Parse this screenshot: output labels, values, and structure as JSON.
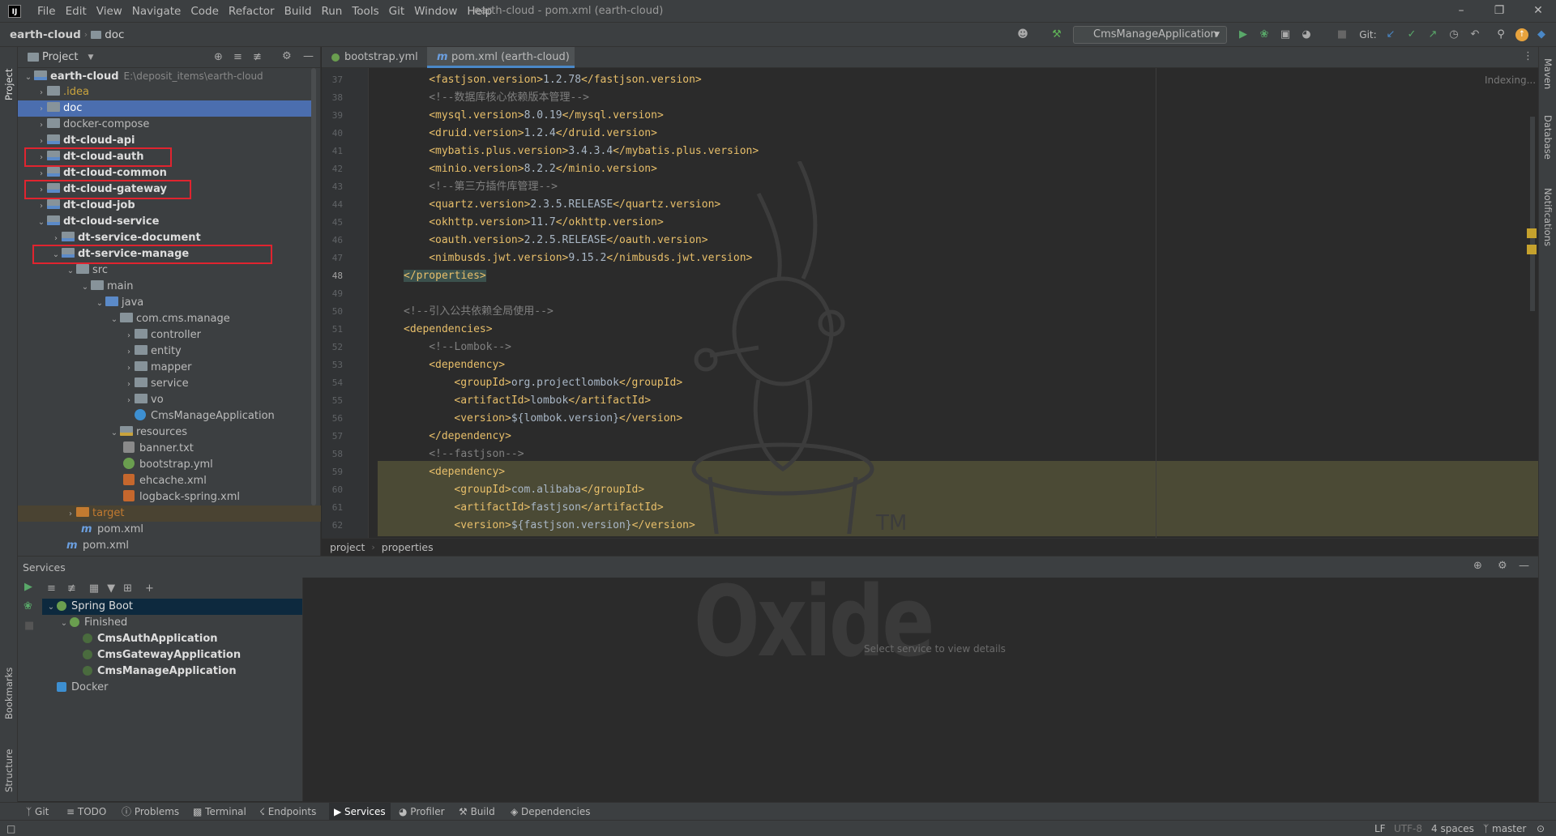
{
  "menubar": {
    "logo": "IJ",
    "items": [
      "File",
      "Edit",
      "View",
      "Navigate",
      "Code",
      "Refactor",
      "Build",
      "Run",
      "Tools",
      "Git",
      "Window",
      "Help"
    ],
    "title": "earth-cloud - pom.xml (earth-cloud)"
  },
  "navbar": {
    "project": "earth-cloud",
    "folder": "doc",
    "run_config": "CmsManageApplication",
    "git_label": "Git:"
  },
  "project_panel": {
    "title": "Project",
    "items": [
      {
        "label": "earth-cloud",
        "path": "E:\\deposit_items\\earth-cloud"
      },
      {
        "label": ".idea"
      },
      {
        "label": "doc"
      },
      {
        "label": "docker-compose"
      },
      {
        "label": "dt-cloud-api"
      },
      {
        "label": "dt-cloud-auth"
      },
      {
        "label": "dt-cloud-common"
      },
      {
        "label": "dt-cloud-gateway"
      },
      {
        "label": "dt-cloud-job"
      },
      {
        "label": "dt-cloud-service"
      },
      {
        "label": "dt-service-document"
      },
      {
        "label": "dt-service-manage"
      },
      {
        "label": "src"
      },
      {
        "label": "main"
      },
      {
        "label": "java"
      },
      {
        "label": "com.cms.manage"
      },
      {
        "label": "controller"
      },
      {
        "label": "entity"
      },
      {
        "label": "mapper"
      },
      {
        "label": "service"
      },
      {
        "label": "vo"
      },
      {
        "label": "CmsManageApplication"
      },
      {
        "label": "resources"
      },
      {
        "label": "banner.txt"
      },
      {
        "label": "bootstrap.yml"
      },
      {
        "label": "ehcache.xml"
      },
      {
        "label": "logback-spring.xml"
      },
      {
        "label": "target"
      },
      {
        "label": "pom.xml"
      },
      {
        "label": "pom.xml"
      }
    ]
  },
  "editor": {
    "tabs": [
      "bootstrap.yml",
      "pom.xml (earth-cloud)"
    ],
    "indexing": "Indexing...",
    "lines": [
      {
        "n": "37",
        "indent": 4,
        "parts": [
          [
            "tag",
            "<fastjson.version>"
          ],
          [
            "txt",
            "1.2.78"
          ],
          [
            "tag",
            "</fastjson.version>"
          ]
        ]
      },
      {
        "n": "38",
        "indent": 4,
        "parts": [
          [
            "cm",
            "<!--数据库核心依赖版本管理-->"
          ]
        ]
      },
      {
        "n": "39",
        "indent": 4,
        "parts": [
          [
            "tag",
            "<mysql.version>"
          ],
          [
            "txt",
            "8.0.19"
          ],
          [
            "tag",
            "</mysql.version>"
          ]
        ]
      },
      {
        "n": "40",
        "indent": 4,
        "parts": [
          [
            "tag",
            "<druid.version>"
          ],
          [
            "txt",
            "1.2.4"
          ],
          [
            "tag",
            "</druid.version>"
          ]
        ]
      },
      {
        "n": "41",
        "indent": 4,
        "parts": [
          [
            "tag",
            "<mybatis.plus.version>"
          ],
          [
            "txt",
            "3.4.3.4"
          ],
          [
            "tag",
            "</mybatis.plus.version>"
          ]
        ]
      },
      {
        "n": "42",
        "indent": 4,
        "parts": [
          [
            "tag",
            "<minio.version>"
          ],
          [
            "txt",
            "8.2.2"
          ],
          [
            "tag",
            "</minio.version>"
          ]
        ]
      },
      {
        "n": "43",
        "indent": 4,
        "parts": [
          [
            "cm",
            "<!--第三方插件库管理-->"
          ]
        ]
      },
      {
        "n": "44",
        "indent": 4,
        "parts": [
          [
            "tag",
            "<quartz.version>"
          ],
          [
            "txt",
            "2.3.5.RELEASE"
          ],
          [
            "tag",
            "</quartz.version>"
          ]
        ]
      },
      {
        "n": "45",
        "indent": 4,
        "parts": [
          [
            "tag",
            "<okhttp.version>"
          ],
          [
            "txt",
            "11.7"
          ],
          [
            "tag",
            "</okhttp.version>"
          ]
        ]
      },
      {
        "n": "46",
        "indent": 4,
        "parts": [
          [
            "tag",
            "<oauth.version>"
          ],
          [
            "txt",
            "2.2.5.RELEASE"
          ],
          [
            "tag",
            "</oauth.version>"
          ]
        ]
      },
      {
        "n": "47",
        "indent": 4,
        "parts": [
          [
            "tag",
            "<nimbusds.jwt.version>"
          ],
          [
            "txt",
            "9.15.2"
          ],
          [
            "tag",
            "</nimbusds.jwt.version>"
          ]
        ]
      },
      {
        "n": "48",
        "indent": 0,
        "parts": [
          [
            "tag",
            "</properties>"
          ]
        ]
      },
      {
        "n": "49",
        "indent": 0,
        "parts": []
      },
      {
        "n": "50",
        "indent": 0,
        "parts": [
          [
            "cm",
            "<!--引入公共依赖全局使用-->"
          ]
        ]
      },
      {
        "n": "51",
        "indent": 0,
        "parts": [
          [
            "tag",
            "<dependencies>"
          ]
        ]
      },
      {
        "n": "52",
        "indent": 4,
        "parts": [
          [
            "cm",
            "<!--Lombok-->"
          ]
        ]
      },
      {
        "n": "53",
        "indent": 4,
        "parts": [
          [
            "tag",
            "<dependency>"
          ]
        ]
      },
      {
        "n": "54",
        "indent": 8,
        "parts": [
          [
            "tag",
            "<groupId>"
          ],
          [
            "txt",
            "org.projectlombok"
          ],
          [
            "tag",
            "</groupId>"
          ]
        ]
      },
      {
        "n": "55",
        "indent": 8,
        "parts": [
          [
            "tag",
            "<artifactId>"
          ],
          [
            "txt",
            "lombok"
          ],
          [
            "tag",
            "</artifactId>"
          ]
        ]
      },
      {
        "n": "56",
        "indent": 8,
        "parts": [
          [
            "tag",
            "<version>"
          ],
          [
            "txt",
            "${lombok.version}"
          ],
          [
            "tag",
            "</version>"
          ]
        ]
      },
      {
        "n": "57",
        "indent": 4,
        "parts": [
          [
            "tag",
            "</dependency>"
          ]
        ]
      },
      {
        "n": "58",
        "indent": 4,
        "parts": [
          [
            "cm",
            "<!--fastjson-->"
          ]
        ]
      },
      {
        "n": "59",
        "indent": 4,
        "parts": [
          [
            "tag",
            "<dependency>"
          ]
        ]
      },
      {
        "n": "60",
        "indent": 8,
        "parts": [
          [
            "tag",
            "<groupId>"
          ],
          [
            "txt",
            "com.alibaba"
          ],
          [
            "tag",
            "</groupId>"
          ]
        ]
      },
      {
        "n": "61",
        "indent": 8,
        "parts": [
          [
            "tag",
            "<artifactId>"
          ],
          [
            "txt",
            "fastjson"
          ],
          [
            "tag",
            "</artifactId>"
          ]
        ]
      },
      {
        "n": "62",
        "indent": 8,
        "parts": [
          [
            "tag",
            "<version>"
          ],
          [
            "txt",
            "${fastjson.version}"
          ],
          [
            "tag",
            "</version>"
          ]
        ]
      }
    ],
    "breadcrumb": [
      "project",
      "properties"
    ]
  },
  "services": {
    "title": "Services",
    "tree": [
      "Spring Boot",
      "Finished",
      "CmsAuthApplication",
      "CmsGatewayApplication",
      "CmsManageApplication",
      "Docker"
    ],
    "detail_hint": "Select service to view details",
    "watermark": "Oxide",
    "tm": "TM"
  },
  "left_strip": [
    "Project",
    "Bookmarks",
    "Structure"
  ],
  "right_strip": [
    "Maven",
    "Database",
    "Notifications"
  ],
  "toolwindows": [
    "Git",
    "TODO",
    "Problems",
    "Terminal",
    "Endpoints",
    "Services",
    "Profiler",
    "Build",
    "Dependencies"
  ],
  "status": {
    "line_sep": "LF",
    "encoding": "UTF-8",
    "indent": "4 spaces",
    "branch": "master"
  }
}
